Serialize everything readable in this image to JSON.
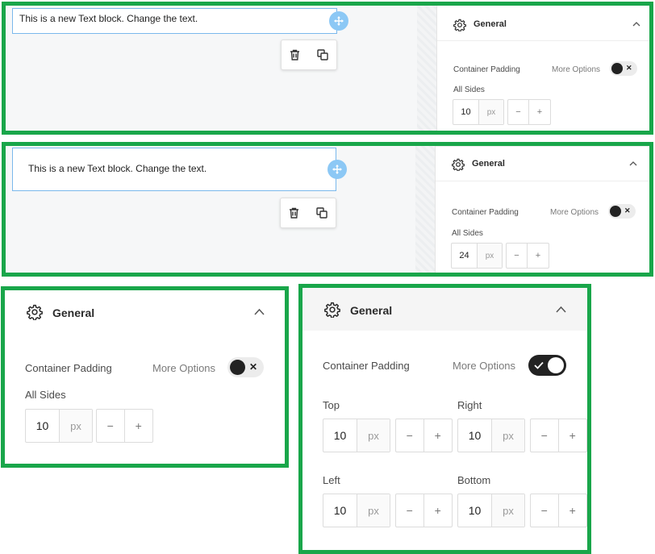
{
  "textblock": {
    "content": "This is a new Text block. Change the text."
  },
  "panel": {
    "title": "General",
    "padding_label": "Container Padding",
    "more_options": "More Options",
    "all_sides": "All Sides",
    "unit": "px",
    "minus": "−",
    "plus": "+",
    "toggle_off_mark": "✕"
  },
  "frame1": {
    "value": "10",
    "more_options_enabled": false
  },
  "frame2": {
    "value": "24",
    "more_options_enabled": false
  },
  "frame3": {
    "value": "10",
    "more_options_enabled": false
  },
  "frame4": {
    "more_options_enabled": true,
    "sides": [
      {
        "label": "Top",
        "value": "10"
      },
      {
        "label": "Right",
        "value": "10"
      },
      {
        "label": "Left",
        "value": "10"
      },
      {
        "label": "Bottom",
        "value": "10"
      }
    ]
  },
  "colors": {
    "frame_border": "#19a64a",
    "selection": "#7ab8ec",
    "handle": "#8cc8f5",
    "toggle": "#222222"
  },
  "icons": [
    "gear-icon",
    "chevron-up-icon",
    "move-icon",
    "trash-icon",
    "duplicate-icon",
    "close-icon",
    "check-icon"
  ]
}
